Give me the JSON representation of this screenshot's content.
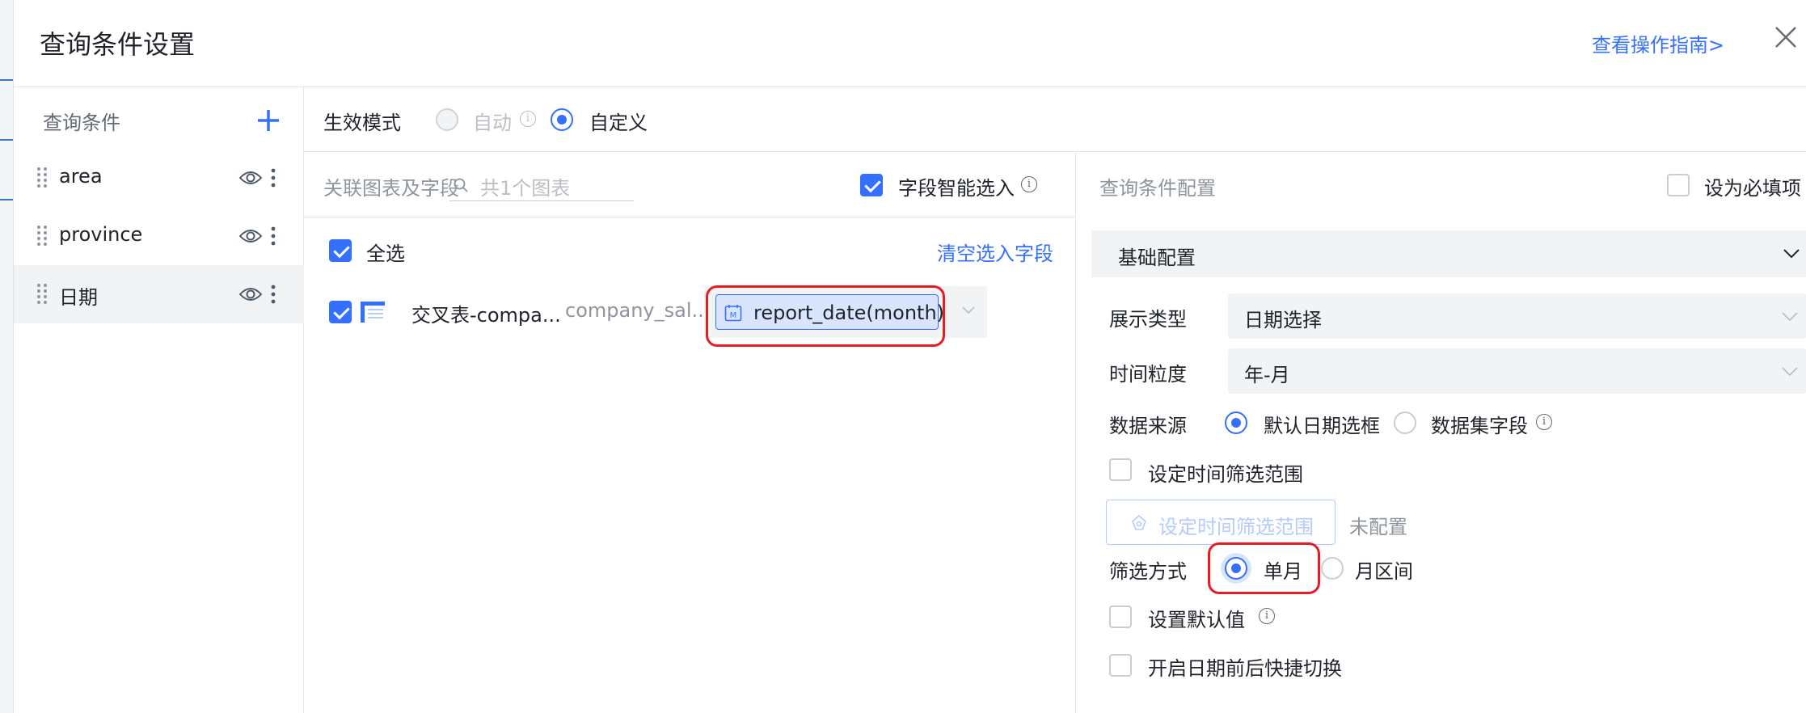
{
  "dialog": {
    "title": "查询条件设置",
    "guide_link": "查看操作指南>",
    "close_icon": "close-icon"
  },
  "conditions": {
    "header": "查询条件",
    "add_icon": "plus-icon",
    "items": [
      {
        "label": "area",
        "selected": false
      },
      {
        "label": "province",
        "selected": false
      },
      {
        "label": "日期",
        "selected": true
      }
    ]
  },
  "mode": {
    "label": "生效模式",
    "options": [
      {
        "label": "自动",
        "checked": false,
        "disabled": true
      },
      {
        "label": "自定义",
        "checked": true,
        "disabled": false
      }
    ]
  },
  "linked": {
    "header": "关联图表及字段",
    "search_placeholder": "共1个图表",
    "smart_select_label": "字段智能选入",
    "smart_select_checked": true,
    "select_all_label": "全选",
    "select_all_checked": true,
    "clear_link": "清空选入字段",
    "rows": [
      {
        "chart_name": "交叉表-compa...",
        "dataset": "company_sal...",
        "field": "report_date(month)",
        "checked": true
      }
    ]
  },
  "config": {
    "header": "查询条件配置",
    "required_label": "设为必填项",
    "required_checked": false,
    "section_title": "基础配置",
    "display_type_label": "展示类型",
    "display_type_value": "日期选择",
    "granularity_label": "时间粒度",
    "granularity_value": "年-月",
    "source_label": "数据来源",
    "source_options": [
      {
        "label": "默认日期选框",
        "checked": true
      },
      {
        "label": "数据集字段",
        "checked": false
      }
    ],
    "time_range_label": "设定时间筛选范围",
    "time_range_checked": false,
    "time_range_button": "设定时间筛选范围",
    "time_range_status": "未配置",
    "filter_mode_label": "筛选方式",
    "filter_mode_options": [
      {
        "label": "单月",
        "checked": true
      },
      {
        "label": "月区间",
        "checked": false
      }
    ],
    "default_value_label": "设置默认值",
    "default_value_checked": false,
    "quick_switch_label": "开启日期前后快捷切换",
    "quick_switch_checked": false
  },
  "colors": {
    "accent": "#3370ff",
    "highlight": "#e51c23"
  }
}
